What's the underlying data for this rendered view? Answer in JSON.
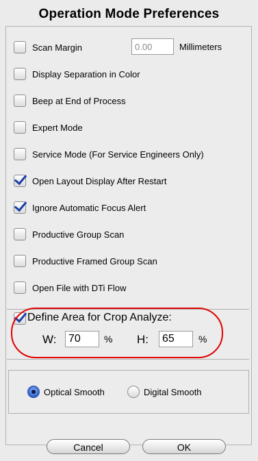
{
  "window": {
    "title": "Operation Mode Preferences"
  },
  "options": [
    {
      "label": "Scan Margin",
      "checked": false
    },
    {
      "label": "Display Separation in Color",
      "checked": false
    },
    {
      "label": "Beep at End of Process",
      "checked": false
    },
    {
      "label": "Expert Mode",
      "checked": false
    },
    {
      "label": "Service Mode (For Service Engineers Only)",
      "checked": false
    },
    {
      "label": "Open Layout Display After Restart",
      "checked": true
    },
    {
      "label": "Ignore Automatic Focus Alert",
      "checked": true
    },
    {
      "label": "Productive Group Scan",
      "checked": false
    },
    {
      "label": "Productive Framed Group Scan",
      "checked": false
    },
    {
      "label": "Open File with DTi Flow",
      "checked": false
    }
  ],
  "scan_margin": {
    "value": "0.00",
    "unit": "Millimeters"
  },
  "crop": {
    "label": "Define Area for Crop Analyze:",
    "checked": true,
    "w_label": "W:",
    "w_value": "70",
    "w_unit": "%",
    "h_label": "H:",
    "h_value": "65",
    "h_unit": "%"
  },
  "smoothing": {
    "optical_label": "Optical Smooth",
    "digital_label": "Digital Smooth",
    "selected": "optical"
  },
  "buttons": {
    "cancel": "Cancel",
    "ok": "OK"
  },
  "colors": {
    "highlight_oval": "#e00000",
    "check_mark": "#1c3fa8"
  }
}
